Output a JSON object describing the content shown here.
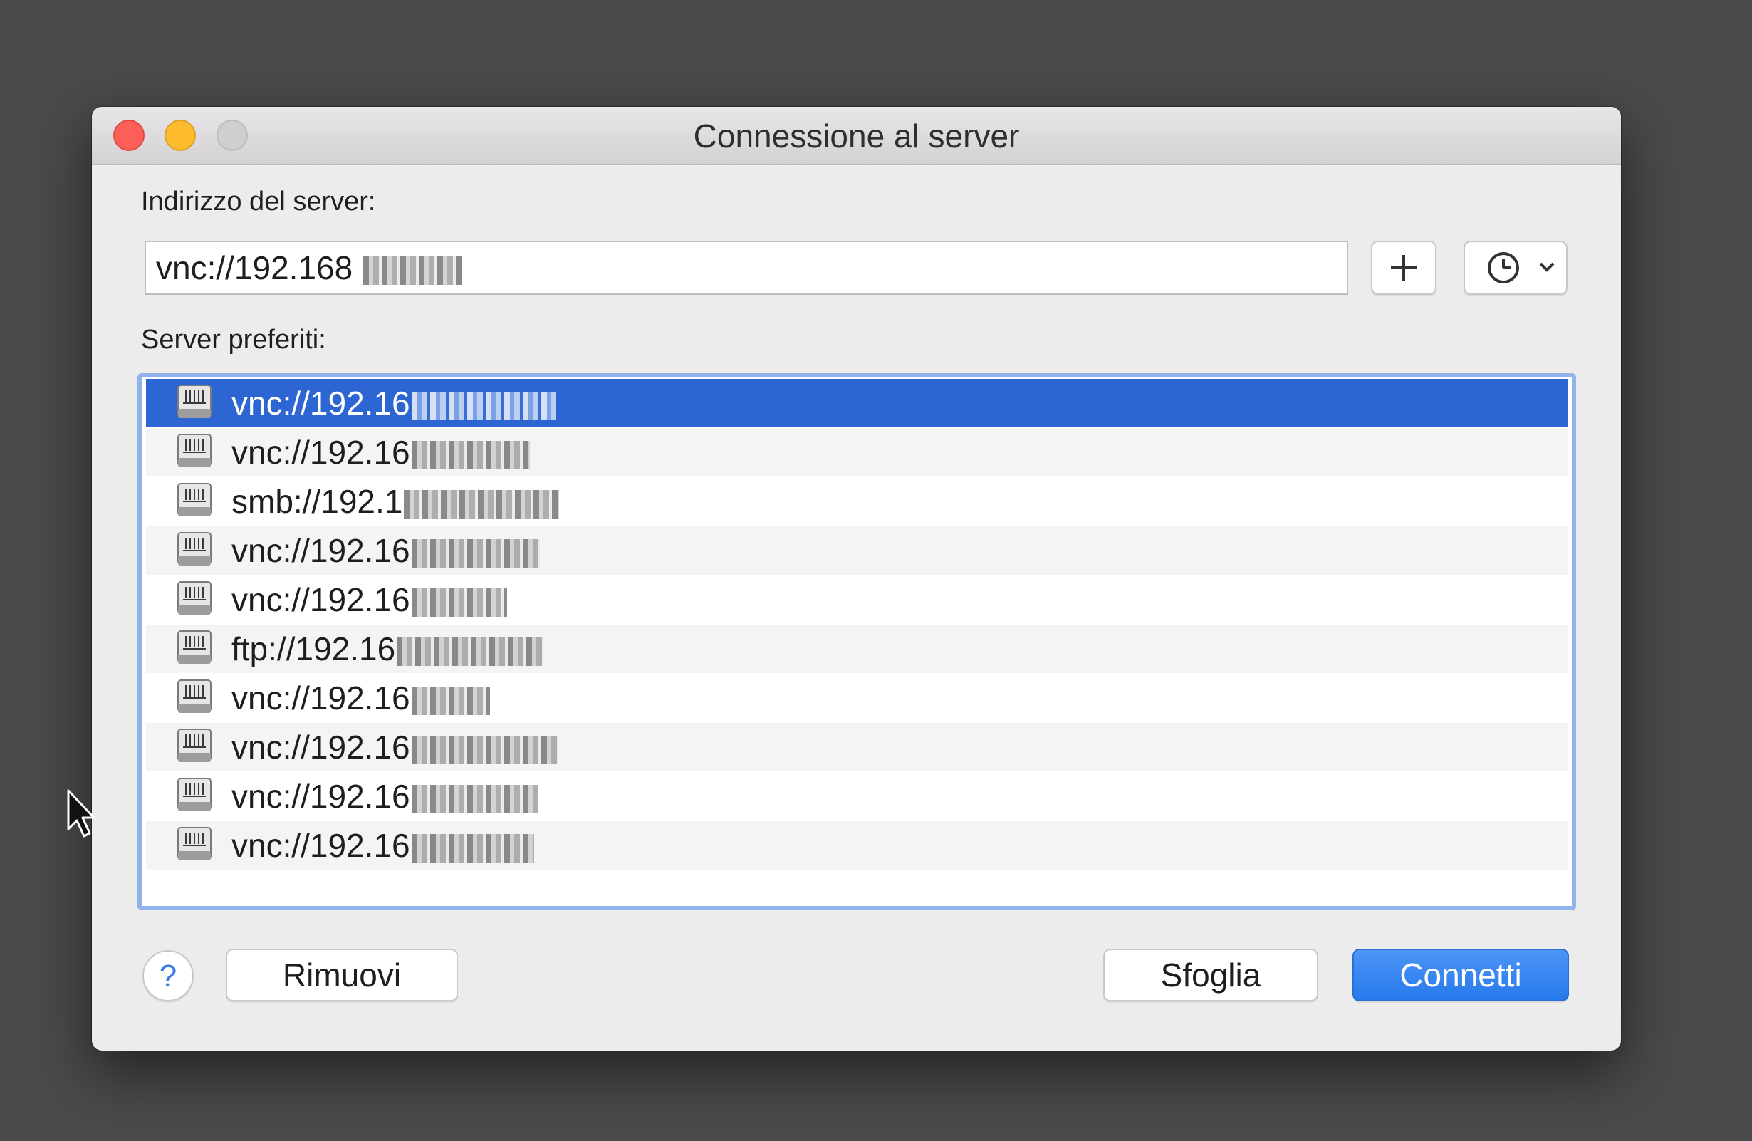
{
  "window": {
    "title": "Connessione al server"
  },
  "address": {
    "label": "Indirizzo del server:",
    "value": "vnc://192.168"
  },
  "favorites": {
    "label": "Server preferiti:",
    "items": [
      {
        "prefix": "vnc://192.16",
        "selected": true
      },
      {
        "prefix": "vnc://192.16",
        "selected": false
      },
      {
        "prefix": "smb://192.1",
        "selected": false
      },
      {
        "prefix": "vnc://192.16",
        "selected": false
      },
      {
        "prefix": "vnc://192.16",
        "selected": false
      },
      {
        "prefix": "ftp://192.16",
        "selected": false
      },
      {
        "prefix": "vnc://192.16",
        "selected": false
      },
      {
        "prefix": "vnc://192.16",
        "selected": false
      },
      {
        "prefix": "vnc://192.16",
        "selected": false
      },
      {
        "prefix": "vnc://192.16",
        "selected": false
      }
    ]
  },
  "buttons": {
    "help": "?",
    "remove": "Rimuovi",
    "browse": "Sfoglia",
    "connect": "Connetti"
  },
  "icons": {
    "add": "plus-icon",
    "history": "clock-icon",
    "history_menu": "chevron-down-icon",
    "server": "server-icon",
    "pointer": "mouse-pointer-icon"
  },
  "colors": {
    "accent": "#2d66d3",
    "list_focus_ring": "#8fb3ea",
    "close": "#fc5f57",
    "minimize": "#fdbc2e",
    "zoom": "#d0cfd0"
  }
}
